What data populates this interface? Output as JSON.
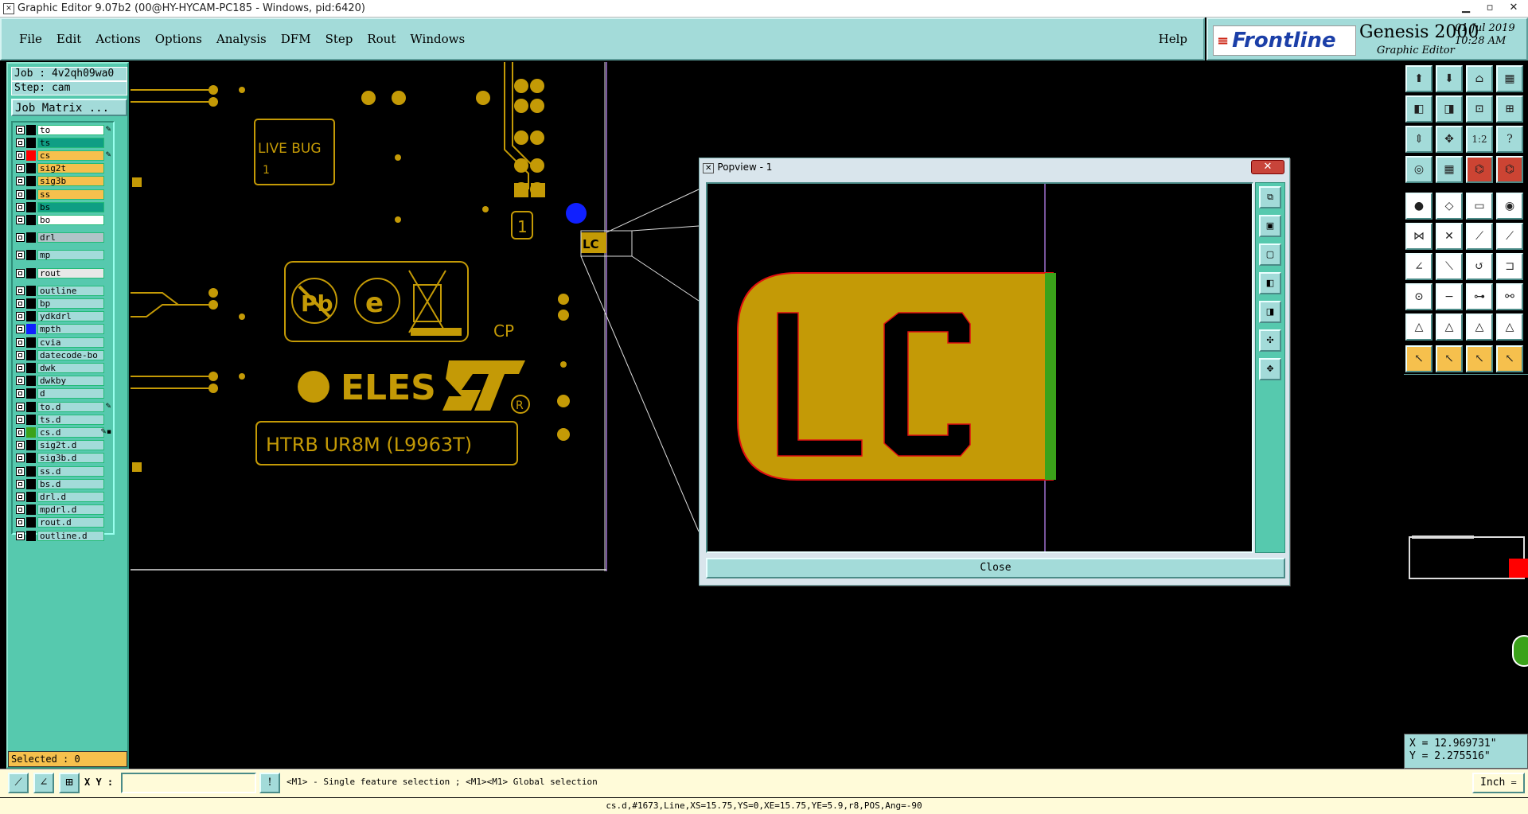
{
  "window": {
    "title": "Graphic Editor 9.07b2 (00@HY-HYCAM-PC185 - Windows, pid:6420)",
    "icon": "x-icon"
  },
  "menu": {
    "items": [
      "File",
      "Edit",
      "Actions",
      "Options",
      "Analysis",
      "DFM",
      "Step",
      "Rout",
      "Windows"
    ],
    "help": "Help"
  },
  "brand": {
    "company": "Frontline",
    "product": "Genesis 2000",
    "subtitle": "Graphic Editor",
    "date": "01 Jul 2019",
    "time": "10:28 AM"
  },
  "job": {
    "job_label": "Job : 4v2qh09wa0",
    "step_label": "Step: cam",
    "matrix_button": "Job Matrix ..."
  },
  "layers": [
    {
      "name": "to",
      "color": "#ffffff",
      "swatch": "#000000",
      "mark": "✎"
    },
    {
      "name": "ts",
      "color": "#0f9e84",
      "swatch": "#000000",
      "mark": ""
    },
    {
      "name": "cs",
      "color": "#f6c04d",
      "swatch": "#ff0000",
      "mark": "✎"
    },
    {
      "name": "sig2t",
      "color": "#f6c04d",
      "swatch": "#000000",
      "mark": ""
    },
    {
      "name": "sig3b",
      "color": "#f6c04d",
      "swatch": "#000000",
      "mark": ""
    },
    {
      "name": "ss",
      "color": "#f6c04d",
      "swatch": "#000000",
      "mark": ""
    },
    {
      "name": "bs",
      "color": "#0f9e84",
      "swatch": "#000000",
      "mark": ""
    },
    {
      "name": "bo",
      "color": "#ffffff",
      "swatch": "#000000",
      "mark": ""
    },
    {
      "name": "drl",
      "color": "#b0c4c8",
      "swatch": "#000000",
      "mark": ""
    },
    {
      "name": "mp",
      "color": "#a3dbd9",
      "swatch": "#000000",
      "mark": ""
    },
    {
      "name": "rout",
      "color": "#e8e8e8",
      "swatch": "#000000",
      "mark": ""
    },
    {
      "name": "outline",
      "color": "#a3dbd9",
      "swatch": "#000000",
      "mark": ""
    },
    {
      "name": "bp",
      "color": "#a3dbd9",
      "swatch": "#000000",
      "mark": ""
    },
    {
      "name": "ydkdrl",
      "color": "#a3dbd9",
      "swatch": "#000000",
      "mark": ""
    },
    {
      "name": "mpth",
      "color": "#a3dbd9",
      "swatch": "#1020ff",
      "mark": ""
    },
    {
      "name": "cvia",
      "color": "#a3dbd9",
      "swatch": "#000000",
      "mark": ""
    },
    {
      "name": "datecode-bo",
      "color": "#a3dbd9",
      "swatch": "#000000",
      "mark": ""
    },
    {
      "name": "dwk",
      "color": "#a3dbd9",
      "swatch": "#000000",
      "mark": ""
    },
    {
      "name": "dwkby",
      "color": "#a3dbd9",
      "swatch": "#000000",
      "mark": ""
    },
    {
      "name": "d",
      "color": "#a3dbd9",
      "swatch": "#000000",
      "mark": ""
    },
    {
      "name": "to.d",
      "color": "#a3dbd9",
      "swatch": "#000000",
      "mark": "✎"
    },
    {
      "name": "ts.d",
      "color": "#a3dbd9",
      "swatch": "#000000",
      "mark": ""
    },
    {
      "name": "cs.d",
      "color": "#a3dbd9",
      "swatch": "#3ba21a",
      "mark": "✎▪"
    },
    {
      "name": "sig2t.d",
      "color": "#a3dbd9",
      "swatch": "#000000",
      "mark": ""
    },
    {
      "name": "sig3b.d",
      "color": "#a3dbd9",
      "swatch": "#000000",
      "mark": ""
    },
    {
      "name": "ss.d",
      "color": "#a3dbd9",
      "swatch": "#000000",
      "mark": ""
    },
    {
      "name": "bs.d",
      "color": "#a3dbd9",
      "swatch": "#000000",
      "mark": ""
    },
    {
      "name": "drl.d",
      "color": "#a3dbd9",
      "swatch": "#000000",
      "mark": ""
    },
    {
      "name": "mpdrl.d",
      "color": "#a3dbd9",
      "swatch": "#000000",
      "mark": ""
    },
    {
      "name": "rout.d",
      "color": "#a3dbd9",
      "swatch": "#000000",
      "mark": ""
    },
    {
      "name": "outline.d",
      "color": "#a3dbd9",
      "swatch": "#000000",
      "mark": ""
    }
  ],
  "selected": "Selected : 0",
  "canvas": {
    "live_bug": "LIVE BUG",
    "live_bug_num": "1",
    "num_box": "1",
    "lc_label": "LC",
    "cp_label": "CP",
    "eles_text": "ELES",
    "pb_text": "Pb",
    "e_text": "e",
    "htrb_text": "HTRB UR8M (L9963T)",
    "registered": "R"
  },
  "popview": {
    "title": "Popview - 1",
    "close_x": "✕",
    "close_button": "Close",
    "lc_text": "LC"
  },
  "toolbar": {
    "xy_label": "X Y :",
    "xy_value": "",
    "info_icon": "!",
    "message": "<M1> - Single feature selection ; <M1><M1> Global selection",
    "unit": "Inch"
  },
  "coords": {
    "x": "X = 12.969731\"",
    "y": "Y = 2.275516\""
  },
  "status": "cs.d,#1673,Line,XS=15.75,YS=0,XE=15.75,YE=5.9,r8,POS,Ang=-90",
  "colors": {
    "panel": "#a3dbd9",
    "side": "#56c9ae",
    "gold": "#c49a06",
    "accent_red": "#c8443a"
  }
}
